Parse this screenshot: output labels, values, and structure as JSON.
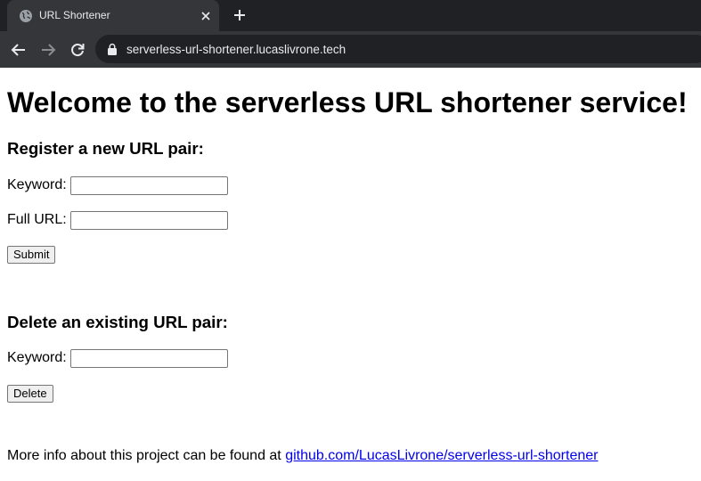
{
  "browser": {
    "tab_title": "URL Shortener",
    "url": "serverless-url-shortener.lucaslivrone.tech",
    "icons": {
      "favicon": "globe-icon",
      "tab_close": "close-icon",
      "new_tab": "plus-icon",
      "back": "arrow-left-icon",
      "forward": "arrow-right-icon",
      "reload": "reload-icon",
      "lock": "lock-icon"
    }
  },
  "page": {
    "heading": "Welcome to the serverless URL shortener service!",
    "register": {
      "heading": "Register a new URL pair:",
      "keyword_label": "Keyword:",
      "keyword_value": "",
      "full_url_label": "Full URL:",
      "full_url_value": "",
      "submit_label": "Submit"
    },
    "delete": {
      "heading": "Delete an existing URL pair:",
      "keyword_label": "Keyword:",
      "keyword_value": "",
      "delete_label": "Delete"
    },
    "footer": {
      "text": "More info about this project can be found at",
      "link_text": "github.com/LucasLivrone/serverless-url-shortener"
    }
  }
}
